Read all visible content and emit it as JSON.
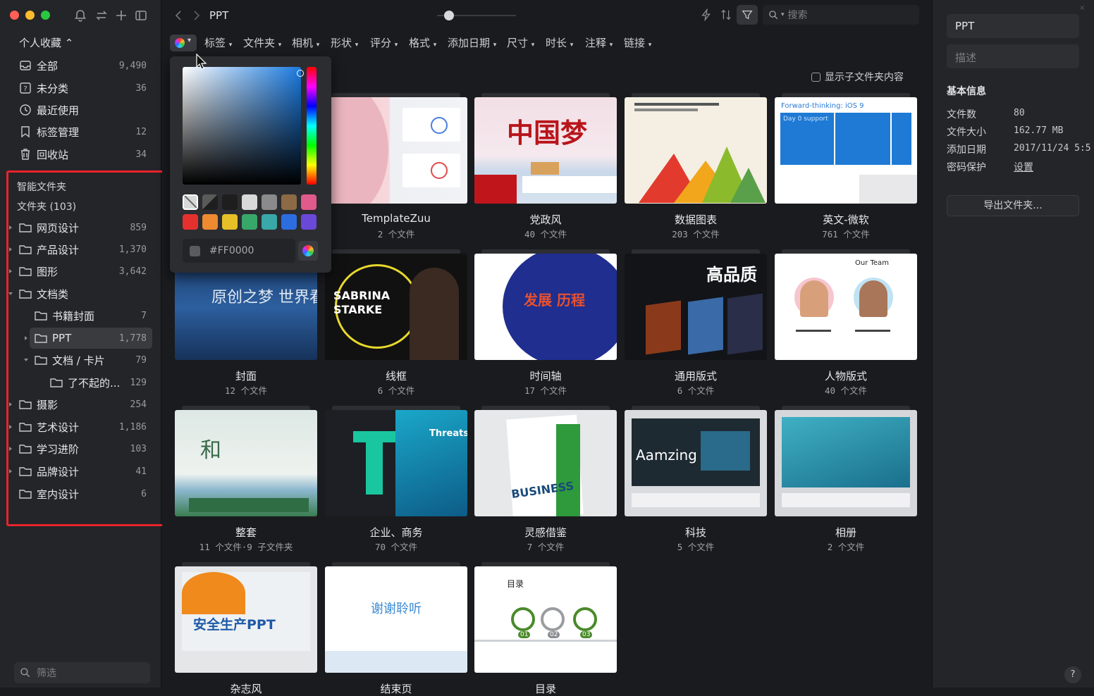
{
  "window": {
    "title": "PPT"
  },
  "sidebar": {
    "collection_title": "个人收藏 ⌃",
    "top_items": [
      {
        "label": "全部",
        "count": "9,490"
      },
      {
        "label": "未分类",
        "count": "36"
      },
      {
        "label": "最近使用",
        "count": ""
      },
      {
        "label": "标签管理",
        "count": "12"
      },
      {
        "label": "回收站",
        "count": "34"
      }
    ],
    "smart_folders": "智能文件夹",
    "folders_header": "文件夹 (103)",
    "folders": [
      {
        "label": "网页设计",
        "count": "859"
      },
      {
        "label": "产品设计",
        "count": "1,370"
      },
      {
        "label": "图形",
        "count": "3,642"
      },
      {
        "label": "文档类",
        "count": ""
      },
      {
        "label": "书籍封面",
        "count": "7"
      },
      {
        "label": "PPT",
        "count": "1,778"
      },
      {
        "label": "文档 / 卡片",
        "count": "79"
      },
      {
        "label": "了不起的...",
        "count": "129"
      },
      {
        "label": "摄影",
        "count": "254"
      },
      {
        "label": "艺术设计",
        "count": "1,186"
      },
      {
        "label": "学习进阶",
        "count": "103"
      },
      {
        "label": "品牌设计",
        "count": "41"
      },
      {
        "label": "室内设计",
        "count": "6"
      }
    ],
    "filter_placeholder": "筛选"
  },
  "toolbar": {
    "title": "PPT",
    "search_placeholder": "搜索",
    "filters": [
      "标签",
      "文件夹",
      "相机",
      "形状",
      "评分",
      "格式",
      "添加日期",
      "尺寸",
      "时长",
      "注释",
      "链接"
    ],
    "show_subfolder": "显示子文件夹内容"
  },
  "color_picker": {
    "hex_value": "#FF0000",
    "swatches": [
      "#d8d8d8",
      "#1e1e1e",
      "#d9d9d9",
      "#8a8a8a",
      "#8c6a45",
      "#e05a8a",
      "#e5312e",
      "#ee8a30",
      "#e6c027",
      "#38a86a",
      "#38a8a8",
      "#2c6de0",
      "#6a48d8"
    ]
  },
  "cards": [
    {
      "name": "TemplateZuu",
      "count": "2 个文件"
    },
    {
      "name": "党政风",
      "count": "40 个文件"
    },
    {
      "name": "数据图表",
      "count": "203 个文件"
    },
    {
      "name": "英文-微软",
      "count": "761 个文件"
    },
    {
      "name": "封面",
      "count": "12 个文件"
    },
    {
      "name": "线框",
      "count": "6 个文件"
    },
    {
      "name": "时间轴",
      "count": "17 个文件"
    },
    {
      "name": "通用版式",
      "count": "6 个文件"
    },
    {
      "name": "人物版式",
      "count": "40 个文件"
    },
    {
      "name": "整套",
      "count": "11 个文件·9 子文件夹"
    },
    {
      "name": "企业、商务",
      "count": "70 个文件"
    },
    {
      "name": "灵感借鉴",
      "count": "7 个文件"
    },
    {
      "name": "科技",
      "count": "5 个文件"
    },
    {
      "name": "相册",
      "count": "2 个文件"
    },
    {
      "name": "杂志风",
      "count": ""
    },
    {
      "name": "结束页",
      "count": ""
    },
    {
      "name": "目录",
      "count": ""
    }
  ],
  "thumb_text": {
    "china_dream": "中国梦",
    "ios": "Forward-thinking: iOS 9",
    "day0": "Day 0 support",
    "cover": "原创之梦 世界看",
    "sabrina": "SABRINA STARKE",
    "timeline": "发展 历程",
    "quality": "高品质",
    "ourteam": "Our Team",
    "he": "和",
    "threats": "Threats",
    "business": "BUSINESS",
    "amazing": "Aamzing",
    "safety": "安全生产PPT",
    "thanks": "谢谢聆听",
    "toc": "目录",
    "toc_nums": [
      "01",
      "02",
      "03"
    ]
  },
  "right_panel": {
    "name": "PPT",
    "desc_placeholder": "描述",
    "section": "基本信息",
    "rows": [
      {
        "key": "文件数",
        "value": "80"
      },
      {
        "key": "文件大小",
        "value": "162.77 MB"
      },
      {
        "key": "添加日期",
        "value": "2017/11/24 5:5"
      },
      {
        "key": "密码保护",
        "value": "设置"
      }
    ],
    "export_button": "导出文件夹...",
    "help": "?"
  },
  "colors": {
    "accent_red": "#e8232c",
    "bg": "#1a1b1e",
    "sidebar_bg": "#242528"
  }
}
